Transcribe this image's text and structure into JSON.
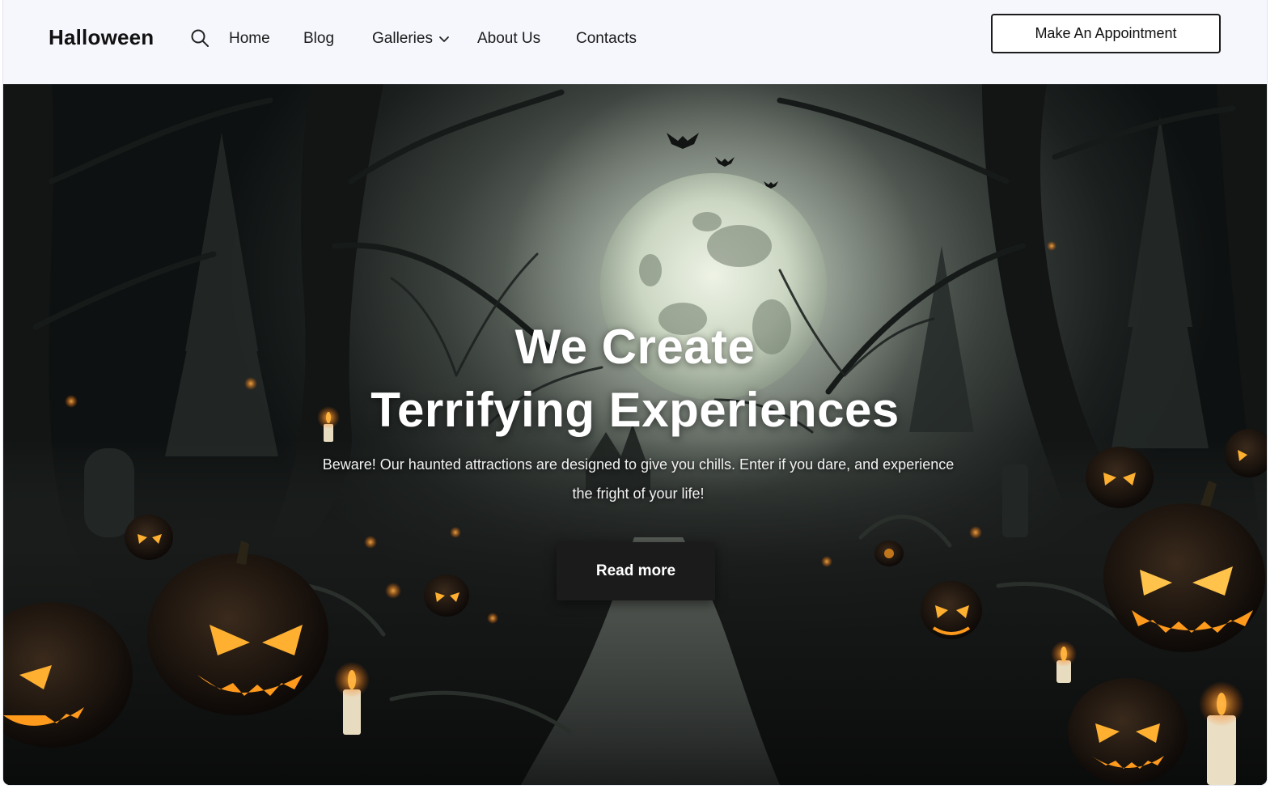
{
  "header": {
    "logo": "Halloween",
    "nav": {
      "home": "Home",
      "blog": "Blog",
      "galleries": "Galleries",
      "about": "About Us",
      "contacts": "Contacts"
    },
    "cta_label": "Make An Appointment"
  },
  "hero": {
    "title_line1": "We Create",
    "title_line2": "Terrifying Experiences",
    "subtitle": "Beware! Our haunted attractions are designed to give you chills. Enter if you dare, and experience the fright of your life!",
    "button_label": "Read more"
  },
  "icons": {
    "search": "search-icon",
    "galleries_dropdown": "chevron-down-icon"
  },
  "colors": {
    "header_bg": "#f6f7fd",
    "text_dark": "#111111",
    "button_dark": "#1b1b1b",
    "pumpkin_orange": "#f08a1c",
    "glow_yellow": "#ffd24a"
  }
}
